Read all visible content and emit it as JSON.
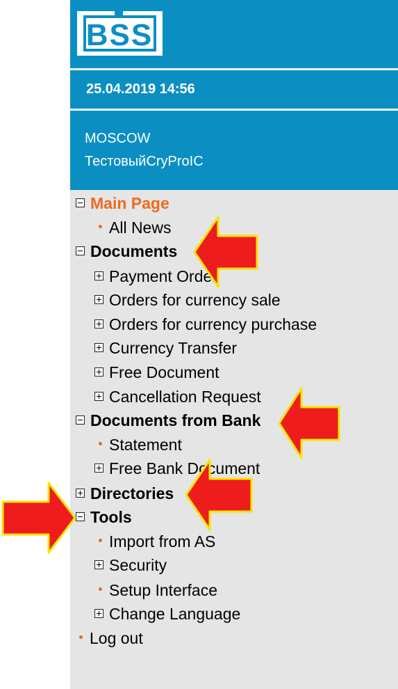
{
  "header": {
    "logo_text": "BSS",
    "datetime": "25.04.2019 14:56",
    "city": "MOSCOW",
    "client": "ТестовыйCryProIC"
  },
  "menu": {
    "main_page": "Main Page",
    "all_news": "All News",
    "documents": "Documents",
    "payment_order": "Payment Order",
    "orders_currency_sale": "Orders for currency sale",
    "orders_currency_purchase": "Orders for currency purchase",
    "currency_transfer": "Currency Transfer",
    "free_document": "Free Document",
    "cancellation_request": "Cancellation Request",
    "documents_from_bank": "Documents from Bank",
    "statement": "Statement",
    "free_bank_document": "Free Bank Document",
    "directories": "Directories",
    "tools": "Tools",
    "import_from_as": "Import from AS",
    "security": "Security",
    "setup_interface": "Setup Interface",
    "change_language": "Change Language",
    "log_out": "Log out"
  },
  "colors": {
    "header_blue": "#0b8fc3",
    "panel_gray": "#e5e5e5",
    "accent_orange": "#ee6a1f",
    "arrow_red": "#ee1c1c",
    "arrow_outline": "#f5e400"
  },
  "icons": {
    "expanded": "minus-box-icon",
    "collapsed": "plus-box-icon",
    "leaf": "bullet-icon",
    "annotation": "red-arrow-icon"
  }
}
